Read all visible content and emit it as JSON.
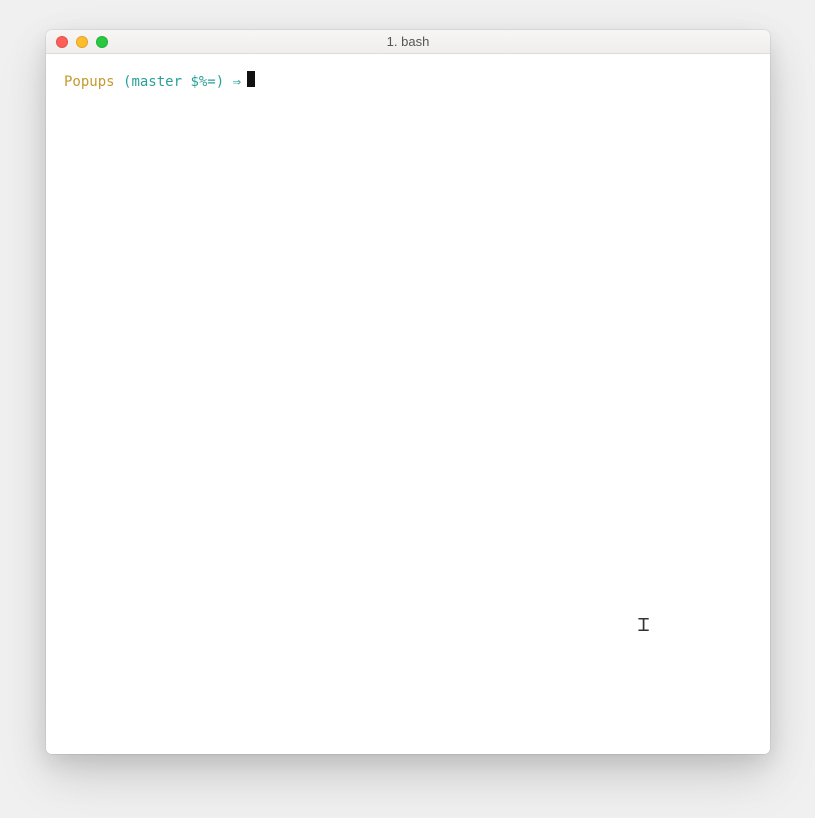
{
  "window": {
    "title": "1. bash"
  },
  "terminal": {
    "prompt": {
      "dir": "Popups",
      "git_branch": "(master $%=)",
      "arrow": "⇒"
    }
  },
  "pointer": {
    "char": "I"
  },
  "colors": {
    "dir": "#c39a2d",
    "git": "#2aa198",
    "traffic_red": "#ff5f57",
    "traffic_yellow": "#ffbd2e",
    "traffic_green": "#28c940"
  }
}
